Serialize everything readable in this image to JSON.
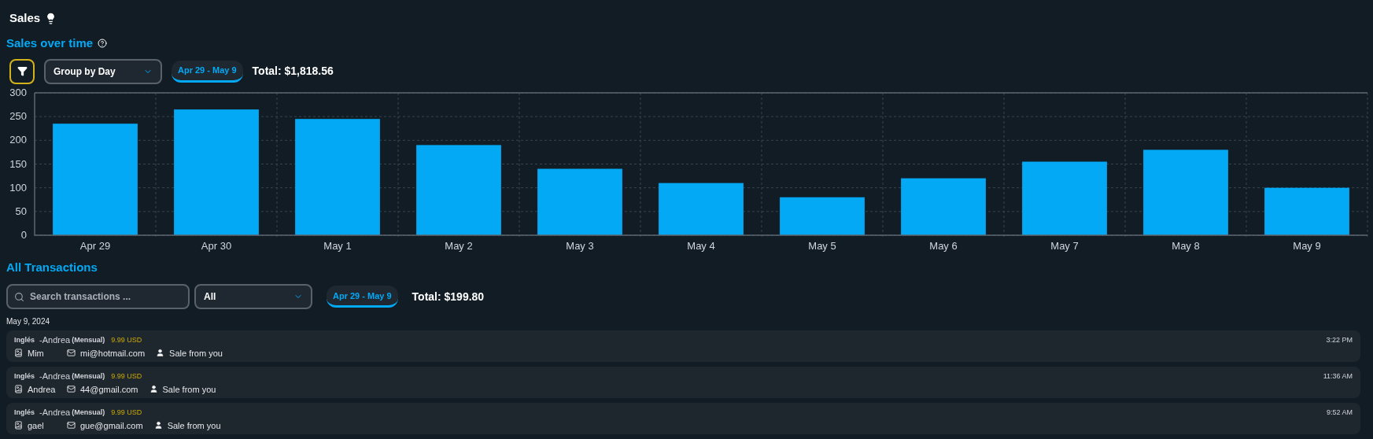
{
  "page": {
    "title": "Sales"
  },
  "sales_over_time": {
    "title": "Sales over time",
    "group_select": {
      "value": "Group by Day"
    },
    "date_range": "Apr 29 - May 9",
    "total": "Total: $1,818.56",
    "chart_data": {
      "type": "bar",
      "categories": [
        "Apr 29",
        "Apr 30",
        "May 1",
        "May 2",
        "May 3",
        "May 4",
        "May 5",
        "May 6",
        "May 7",
        "May 8",
        "May 9"
      ],
      "grid": true,
      "series": [
        {
          "color": "#03a9f4",
          "values": [
            235,
            265,
            245,
            190,
            140,
            110,
            80,
            120,
            155,
            180,
            100
          ]
        }
      ],
      "ylim": [
        0,
        300
      ],
      "yticks": [
        0,
        50,
        100,
        150,
        200,
        250,
        300
      ]
    }
  },
  "transactions": {
    "title": "All Transactions",
    "search": {
      "placeholder": "Search transactions ..."
    },
    "type_select": {
      "value": "All"
    },
    "date_range": "Apr 29 - May 9",
    "total": "Total: $199.80",
    "groups": [
      {
        "date": "May 9, 2024",
        "items": [
          {
            "course": "Inglés",
            "teacher": "-Andrea",
            "plan": "(Mensual)",
            "price": "9.99 USD",
            "time": "3:22 PM",
            "student": "Mim",
            "email": "mi@hotmail.com",
            "source": "Sale from you"
          },
          {
            "course": "Inglés",
            "teacher": "-Andrea",
            "plan": "(Mensual)",
            "price": "9.99 USD",
            "time": "11:36 AM",
            "student": "Andrea",
            "email": "44@gmail.com",
            "source": "Sale from you"
          },
          {
            "course": "Inglés",
            "teacher": "-Andrea",
            "plan": "(Mensual)",
            "price": "9.99 USD",
            "time": "9:52 AM",
            "student": "gael",
            "email": "gue@gmail.com",
            "source": "Sale from you"
          }
        ]
      }
    ]
  }
}
